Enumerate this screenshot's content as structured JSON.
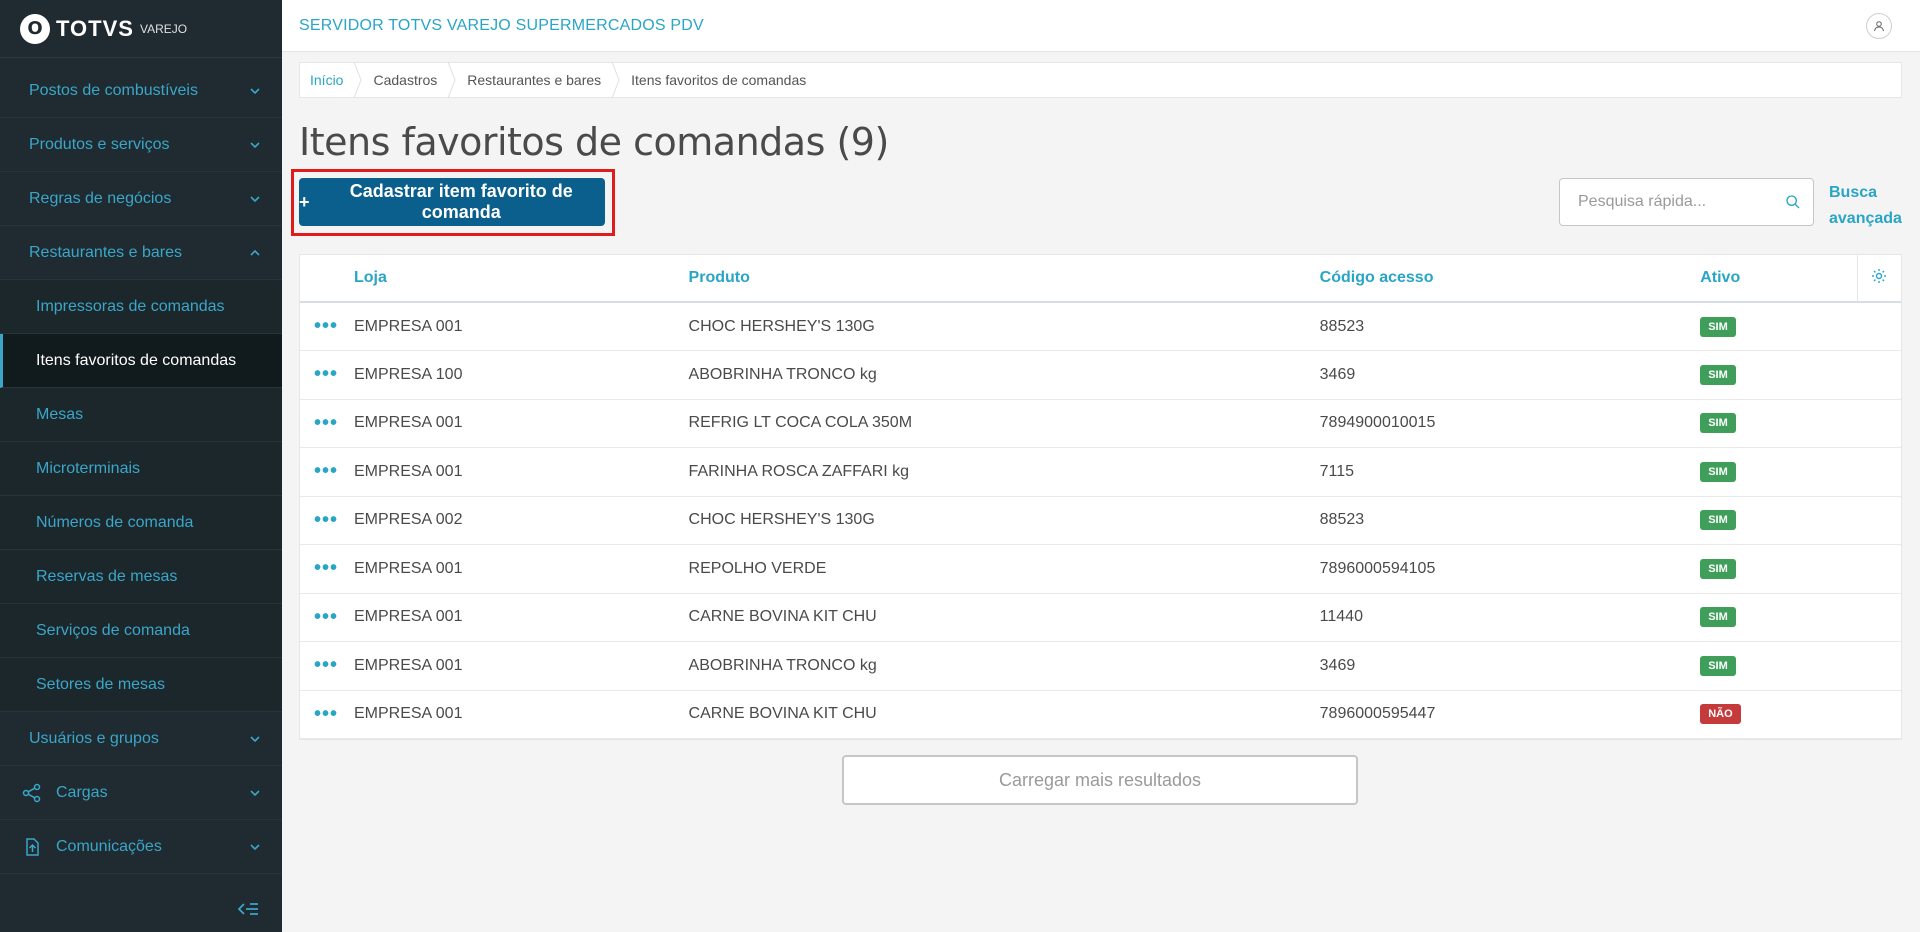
{
  "brand": {
    "name": "TOTVS",
    "product": "VAREJO",
    "mark": "O"
  },
  "sidebar": {
    "items": [
      {
        "label": "Postos de combustíveis"
      },
      {
        "label": "Produtos e serviços"
      },
      {
        "label": "Regras de negócios"
      },
      {
        "label": "Restaurantes e bares"
      }
    ],
    "subitems": [
      {
        "label": "Impressoras de comandas"
      },
      {
        "label": "Itens favoritos de comandas"
      },
      {
        "label": "Mesas"
      },
      {
        "label": "Microterminais"
      },
      {
        "label": "Números de comanda"
      },
      {
        "label": "Reservas de mesas"
      },
      {
        "label": "Serviços de comanda"
      },
      {
        "label": "Setores de mesas"
      }
    ],
    "after_items": [
      {
        "label": "Usuários e grupos"
      },
      {
        "label": "Cargas"
      },
      {
        "label": "Comunicações"
      }
    ]
  },
  "header": {
    "server_title": "SERVIDOR TOTVS VAREJO SUPERMERCADOS PDV"
  },
  "breadcrumb": [
    "Início",
    "Cadastros",
    "Restaurantes e bares",
    "Itens favoritos de comandas"
  ],
  "page": {
    "title": "Itens favoritos de comandas (9)",
    "add_button": "Cadastrar item favorito de comanda",
    "add_plus": "+",
    "search_placeholder": "Pesquisa rápida...",
    "advanced_search_line1": "Busca",
    "advanced_search_line2": "avançada",
    "load_more": "Carregar mais resultados"
  },
  "table": {
    "columns": {
      "loja": "Loja",
      "produto": "Produto",
      "codigo": "Código acesso",
      "ativo": "Ativo"
    },
    "rows": [
      {
        "actions": "•••",
        "loja": "EMPRESA 001",
        "produto": "CHOC HERSHEY'S 130G",
        "codigo": "88523",
        "ativo": "SIM"
      },
      {
        "actions": "•••",
        "loja": "EMPRESA 100",
        "produto": "ABOBRINHA TRONCO kg",
        "codigo": "3469",
        "ativo": "SIM"
      },
      {
        "actions": "•••",
        "loja": "EMPRESA 001",
        "produto": "REFRIG LT COCA COLA 350M",
        "codigo": "7894900010015",
        "ativo": "SIM"
      },
      {
        "actions": "•••",
        "loja": "EMPRESA 001",
        "produto": "FARINHA ROSCA ZAFFARI kg",
        "codigo": "7115",
        "ativo": "SIM"
      },
      {
        "actions": "•••",
        "loja": "EMPRESA 002",
        "produto": "CHOC HERSHEY'S 130G",
        "codigo": "88523",
        "ativo": "SIM"
      },
      {
        "actions": "•••",
        "loja": "EMPRESA 001",
        "produto": "REPOLHO VERDE",
        "codigo": "7896000594105",
        "ativo": "SIM"
      },
      {
        "actions": "•••",
        "loja": "EMPRESA 001",
        "produto": "CARNE BOVINA KIT CHU",
        "codigo": "11440",
        "ativo": "SIM"
      },
      {
        "actions": "•••",
        "loja": "EMPRESA 001",
        "produto": "ABOBRINHA TRONCO kg",
        "codigo": "3469",
        "ativo": "SIM"
      },
      {
        "actions": "•••",
        "loja": "EMPRESA 001",
        "produto": "CARNE BOVINA KIT CHU",
        "codigo": "7896000595447",
        "ativo": "NÃO"
      }
    ]
  },
  "colors": {
    "sidebar_bg": "#1f2b30",
    "accent": "#29a5c6",
    "primary_button": "#0b5f8c",
    "badge_yes": "#3f9e5a",
    "badge_no": "#c53a3a",
    "highlight": "#e01b1b"
  }
}
